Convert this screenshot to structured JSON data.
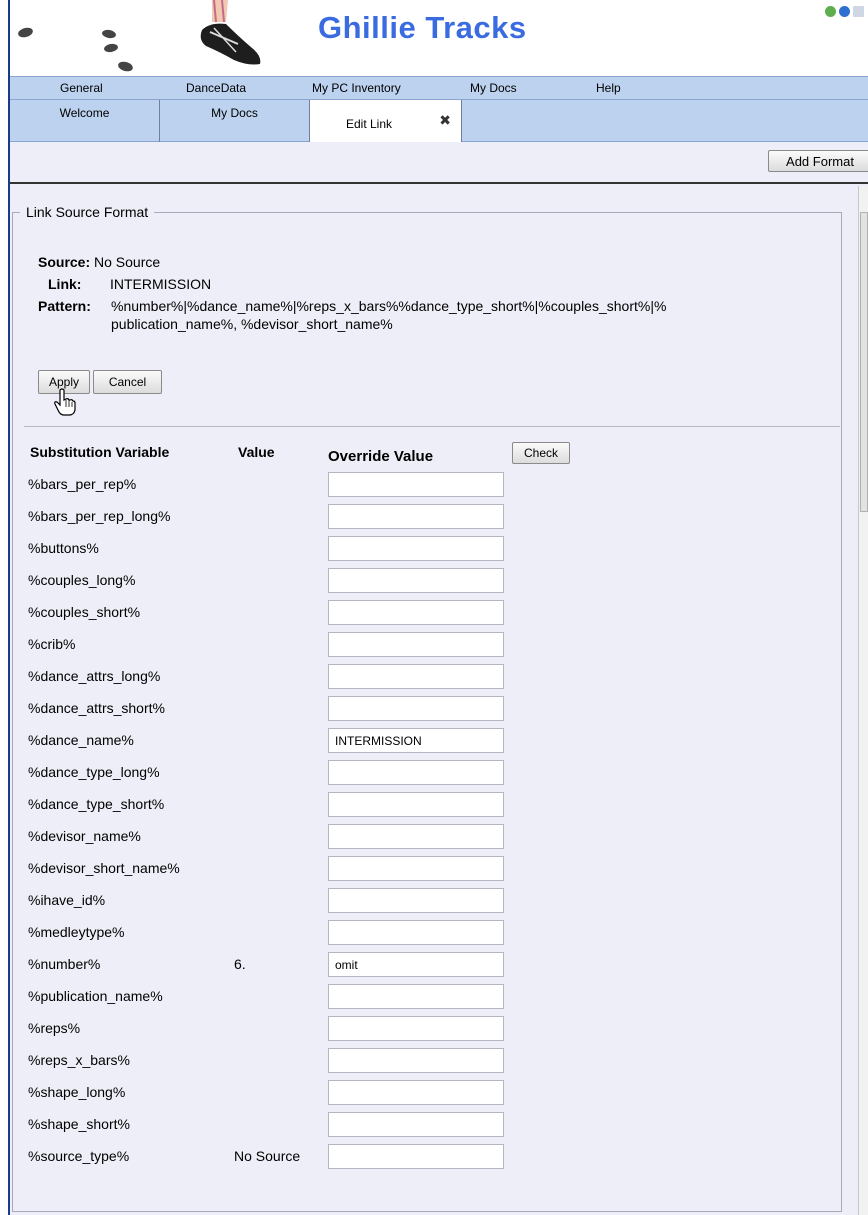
{
  "app": {
    "title": "Ghillie Tracks"
  },
  "menu": [
    "General",
    "DanceData",
    "My PC Inventory",
    "My Docs",
    "Help"
  ],
  "tabs": [
    "Welcome",
    "My Docs",
    "Edit Link"
  ],
  "toolbar": {
    "add_format_label": "Add Format"
  },
  "format": {
    "legend": "Link Source Format",
    "source_label": "Source:",
    "source_value": "No Source",
    "link_label": "Link:",
    "link_value": "INTERMISSION",
    "pattern_label": "Pattern:",
    "pattern_line1": "%number%|%dance_name%|%reps_x_bars%%dance_type_short%|%couples_short%|%",
    "pattern_line2": "publication_name%, %devisor_short_name%",
    "apply_label": "Apply",
    "cancel_label": "Cancel"
  },
  "table": {
    "header_variable": "Substitution Variable",
    "header_value": "Value",
    "header_override": "Override Value",
    "check_label": "Check",
    "rows": [
      {
        "var": "%bars_per_rep%",
        "value": "",
        "override": ""
      },
      {
        "var": "%bars_per_rep_long%",
        "value": "",
        "override": ""
      },
      {
        "var": "%buttons%",
        "value": "",
        "override": ""
      },
      {
        "var": "%couples_long%",
        "value": "",
        "override": ""
      },
      {
        "var": "%couples_short%",
        "value": "",
        "override": ""
      },
      {
        "var": "%crib%",
        "value": "",
        "override": ""
      },
      {
        "var": "%dance_attrs_long%",
        "value": "",
        "override": ""
      },
      {
        "var": "%dance_attrs_short%",
        "value": "",
        "override": ""
      },
      {
        "var": "%dance_name%",
        "value": "",
        "override": "INTERMISSION"
      },
      {
        "var": "%dance_type_long%",
        "value": "",
        "override": ""
      },
      {
        "var": "%dance_type_short%",
        "value": "",
        "override": ""
      },
      {
        "var": "%devisor_name%",
        "value": "",
        "override": ""
      },
      {
        "var": "%devisor_short_name%",
        "value": "",
        "override": ""
      },
      {
        "var": "%ihave_id%",
        "value": "",
        "override": ""
      },
      {
        "var": "%medleytype%",
        "value": "",
        "override": ""
      },
      {
        "var": "%number%",
        "value": "6.",
        "override": "omit"
      },
      {
        "var": "%publication_name%",
        "value": "",
        "override": ""
      },
      {
        "var": "%reps%",
        "value": "",
        "override": ""
      },
      {
        "var": "%reps_x_bars%",
        "value": "",
        "override": ""
      },
      {
        "var": "%shape_long%",
        "value": "",
        "override": ""
      },
      {
        "var": "%shape_short%",
        "value": "",
        "override": ""
      },
      {
        "var": "%source_type%",
        "value": "No Source",
        "override": ""
      }
    ]
  },
  "colors": {
    "title": "#3a6be0",
    "menubar": "#bcd2ef",
    "content_bg": "#eeeef8"
  },
  "icons": {
    "top_right": [
      "refresh-icon",
      "help-icon",
      "document-icon"
    ],
    "tab_close": "close-icon",
    "cursor": "hand-pointer-icon"
  }
}
